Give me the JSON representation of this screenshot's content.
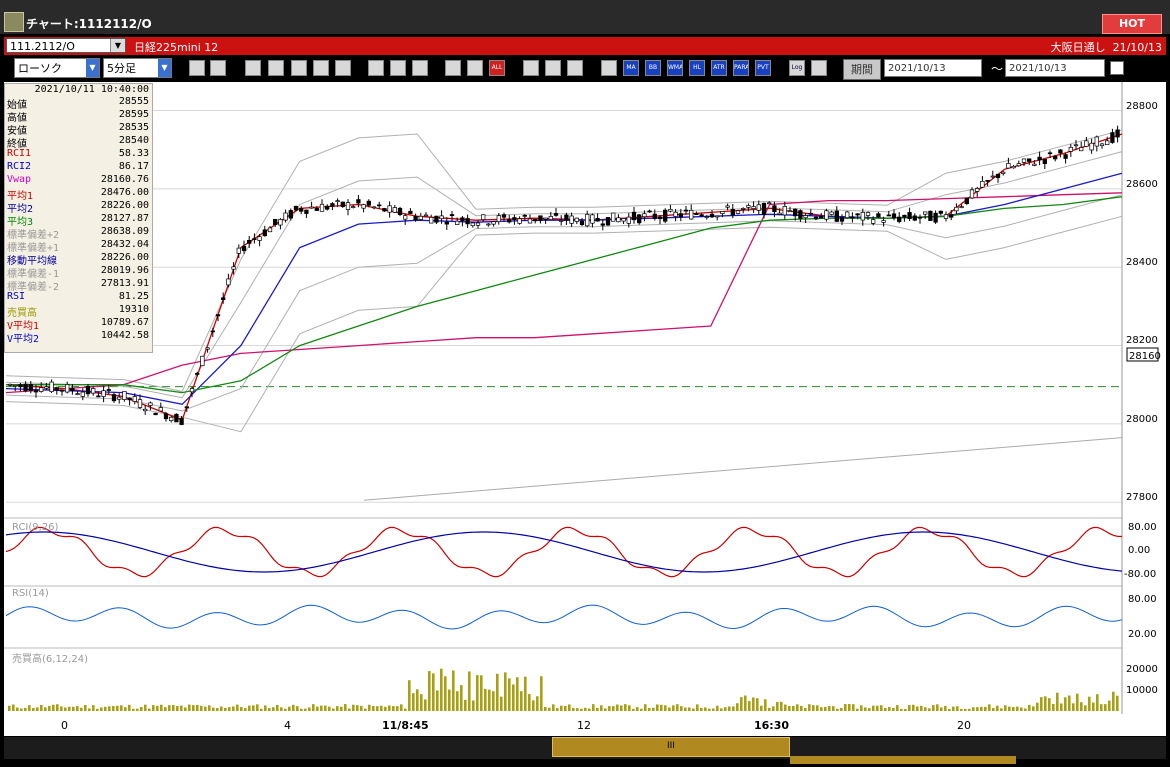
{
  "window": {
    "title": "チャート:1112112/O",
    "hot_label": "HOT"
  },
  "symbol_bar": {
    "code": "111.2112/O",
    "instrument": "日経225mini 12",
    "session": "大阪日通し",
    "date": "21/10/13"
  },
  "toolbar": {
    "chart_type": "ローソク",
    "interval": "5分足",
    "period_label": "期間",
    "date_from": "2021/10/13",
    "date_to": "2021/10/13",
    "tilde": "～",
    "buttons": [
      "ALL",
      "MA",
      "BB",
      "WMA",
      "HL",
      "ATR",
      "PARA",
      "PVT",
      "Log"
    ]
  },
  "info_panel": {
    "datetime": "2021/10/11  10:40:00",
    "rows": [
      {
        "label": "始値",
        "value": "28555",
        "color": "#000000"
      },
      {
        "label": "高値",
        "value": "28595",
        "color": "#000000"
      },
      {
        "label": "安値",
        "value": "28535",
        "color": "#000000"
      },
      {
        "label": "終値",
        "value": "28540",
        "color": "#000000"
      },
      {
        "label": "RCI1",
        "value": "58.33",
        "color": "#cc0000"
      },
      {
        "label": "RCI2",
        "value": "86.17",
        "color": "#0000cc"
      },
      {
        "label": "Vwap",
        "value": "28160.76",
        "color": "#cc00cc"
      },
      {
        "label": "平均1",
        "value": "28476.00",
        "color": "#cc0000"
      },
      {
        "label": "平均2",
        "value": "28226.00",
        "color": "#000099"
      },
      {
        "label": "平均3",
        "value": "28127.87",
        "color": "#008800"
      },
      {
        "label": "標準偏差+2",
        "value": "28638.09",
        "color": "#999999"
      },
      {
        "label": "標準偏差+1",
        "value": "28432.04",
        "color": "#999999"
      },
      {
        "label": "移動平均線",
        "value": "28226.00",
        "color": "#000099"
      },
      {
        "label": "標準偏差-1",
        "value": "28019.96",
        "color": "#999999"
      },
      {
        "label": "標準偏差-2",
        "value": "27813.91",
        "color": "#999999"
      },
      {
        "label": "RSI",
        "value": "81.25",
        "color": "#0000cc"
      },
      {
        "label": "売買高",
        "value": "19310",
        "color": "#999900"
      },
      {
        "label": "V平均1",
        "value": "10789.67",
        "color": "#cc0000"
      },
      {
        "label": "V平均2",
        "value": "10442.58",
        "color": "#0000cc"
      }
    ]
  },
  "price_axis": {
    "ticks": [
      "28800",
      "28600",
      "28400",
      "28200",
      "28000",
      "27800"
    ],
    "current": "28160"
  },
  "rci_panel": {
    "label": "RCI(9,26)",
    "ticks": [
      "80.00",
      "0.00",
      "-80.00"
    ]
  },
  "rsi_panel": {
    "label": "RSI(14)",
    "ticks": [
      "80.00",
      "20.00"
    ]
  },
  "volume_panel": {
    "label": "売買高(6,12,24)",
    "ticks": [
      "20000",
      "10000"
    ]
  },
  "time_axis": {
    "labels": [
      "0",
      "4",
      "11/8:45",
      "12",
      "16:30",
      "20"
    ]
  },
  "colors": {
    "candle_up": "#000000",
    "rci_fast": "#cc0000",
    "rci_slow": "#0000aa",
    "rsi": "#1060d0",
    "vwap": "#d0106a",
    "ma_short": "#cc0000",
    "ma_mid": "#1a1acc",
    "ma_long": "#118811",
    "bands": "#b0b0b0",
    "volume": "#a8a010"
  },
  "chart_data": {
    "type": "line",
    "ylim": [
      27770,
      28860
    ],
    "series": [
      {
        "name": "Vwap",
        "values": [
          28080,
          28090,
          28100,
          28150,
          28180,
          28190,
          28200,
          28210,
          28220,
          28220,
          28230,
          28240,
          28250,
          28560,
          28570,
          28570,
          28575,
          28580,
          28585,
          28590
        ]
      },
      {
        "name": "平均1",
        "values": [
          28100,
          28090,
          28070,
          28010,
          28450,
          28550,
          28560,
          28530,
          28520,
          28525,
          28520,
          28530,
          28540,
          28550,
          28530,
          28525,
          28530,
          28650,
          28690,
          28740
        ]
      },
      {
        "name": "平均2",
        "values": [
          28090,
          28085,
          28080,
          28050,
          28200,
          28450,
          28510,
          28520,
          28515,
          28520,
          28520,
          28525,
          28530,
          28535,
          28530,
          28525,
          28530,
          28560,
          28600,
          28640
        ]
      },
      {
        "name": "平均3",
        "values": [
          28100,
          28100,
          28100,
          28080,
          28110,
          28200,
          28250,
          28300,
          28340,
          28380,
          28420,
          28460,
          28500,
          28520,
          28525,
          28525,
          28530,
          28550,
          28560,
          28580
        ]
      }
    ]
  }
}
